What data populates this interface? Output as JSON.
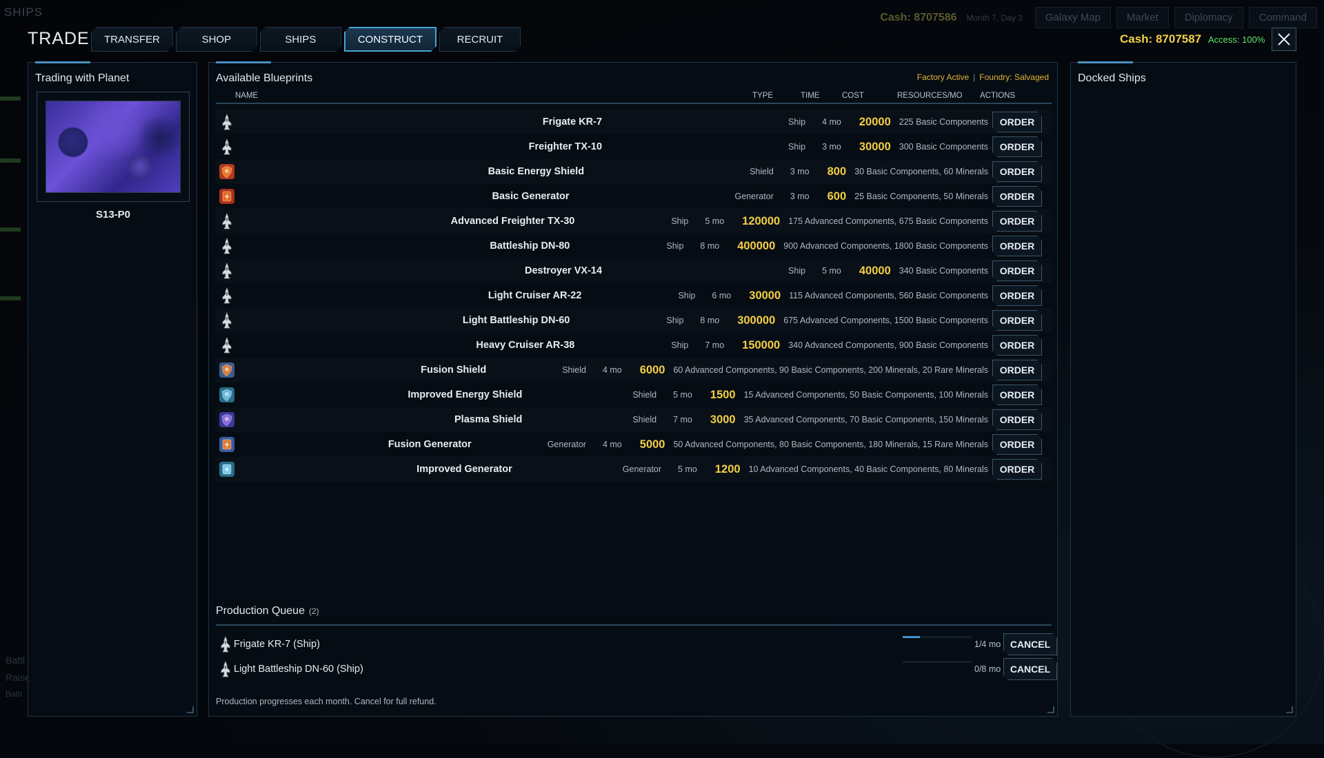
{
  "background": {
    "title": "SHIPS",
    "cash": "Cash: 8707586",
    "date": "Month 7, Day 3",
    "nav": [
      "Galaxy Map",
      "Market",
      "Diplomacy",
      "Command"
    ],
    "bottom_lines": [
      "Battl",
      "Raise",
      "Battl"
    ]
  },
  "header": {
    "title": "TRADE",
    "tabs": [
      {
        "label": "TRANSFER",
        "active": false
      },
      {
        "label": "SHOP",
        "active": false
      },
      {
        "label": "SHIPS",
        "active": false
      },
      {
        "label": "CONSTRUCT",
        "active": true
      },
      {
        "label": "RECRUIT",
        "active": false
      }
    ],
    "cash": "Cash: 8707587",
    "access": "Access: 100%"
  },
  "left_panel": {
    "title": "Trading with Planet",
    "planet_name": "S13-P0"
  },
  "blueprints": {
    "title": "Available Blueprints",
    "status": {
      "factory": "Factory Active",
      "separator": "|",
      "foundry": "Foundry: Salvaged"
    },
    "columns": {
      "name": "NAME",
      "type": "TYPE",
      "time": "TIME",
      "cost": "COST",
      "resources": "RESOURCES/MO",
      "actions": "ACTIONS"
    },
    "order_label": "ORDER",
    "rows": [
      {
        "name": "Frigate KR-7",
        "type": "Ship",
        "time": "4 mo",
        "cost": "20000",
        "resources": "225 Basic Components",
        "icon": "ship-icon",
        "gap": 270
      },
      {
        "name": "Freighter TX-10",
        "type": "Ship",
        "time": "3 mo",
        "cost": "30000",
        "resources": "300 Basic Components",
        "icon": "ship-icon",
        "gap": 270
      },
      {
        "name": "Basic Energy Shield",
        "type": "Shield",
        "time": "3 mo",
        "cost": "800",
        "resources": "30 Basic Components, 60 Minerals",
        "icon": "shield-icon",
        "gap": 240
      },
      {
        "name": "Basic Generator",
        "type": "Generator",
        "time": "3 mo",
        "cost": "600",
        "resources": "25 Basic Components, 50 Minerals",
        "icon": "generator-icon",
        "gap": 240
      },
      {
        "name": "Advanced Freighter TX-30",
        "type": "Ship",
        "time": "5 mo",
        "cost": "120000",
        "resources": "175 Advanced Components, 675 Basic Components",
        "icon": "ship-icon",
        "gap": 140
      },
      {
        "name": "Battleship DN-80",
        "type": "Ship",
        "time": "8 mo",
        "cost": "400000",
        "resources": "900 Advanced Components, 1800 Basic Components",
        "icon": "ship-icon",
        "gap": 140
      },
      {
        "name": "Destroyer VX-14",
        "type": "Ship",
        "time": "5 mo",
        "cost": "40000",
        "resources": "340 Basic Components",
        "icon": "ship-icon",
        "gap": 270
      },
      {
        "name": "Light Cruiser AR-22",
        "type": "Ship",
        "time": "6 mo",
        "cost": "30000",
        "resources": "115 Advanced Components, 560 Basic Components",
        "icon": "ship-icon",
        "gap": 140
      },
      {
        "name": "Light Battleship DN-60",
        "type": "Ship",
        "time": "8 mo",
        "cost": "300000",
        "resources": "675 Advanced Components, 1500 Basic Components",
        "icon": "ship-icon",
        "gap": 140
      },
      {
        "name": "Heavy Cruiser AR-38",
        "type": "Ship",
        "time": "7 mo",
        "cost": "150000",
        "resources": "340 Advanced Components, 900 Basic Components",
        "icon": "ship-icon",
        "gap": 140
      },
      {
        "name": "Fusion Shield",
        "type": "Shield",
        "time": "4 mo",
        "cost": "6000",
        "resources": "60 Advanced Components, 90 Basic Components, 200 Minerals, 20 Rare Minerals",
        "icon": "shield-icon",
        "gap": 110
      },
      {
        "name": "Improved Energy Shield",
        "type": "Shield",
        "time": "5 mo",
        "cost": "1500",
        "resources": "15 Advanced Components, 50 Basic Components, 100 Minerals",
        "icon": "shield-icon",
        "gap": 160
      },
      {
        "name": "Plasma Shield",
        "type": "Shield",
        "time": "7 mo",
        "cost": "3000",
        "resources": "35 Advanced Components, 70 Basic Components, 150 Minerals",
        "icon": "shield-icon",
        "gap": 160
      },
      {
        "name": "Fusion Generator",
        "type": "Generator",
        "time": "4 mo",
        "cost": "5000",
        "resources": "50 Advanced Components, 80 Basic Components, 180 Minerals, 15 Rare Minerals",
        "icon": "generator-icon",
        "gap": 110
      },
      {
        "name": "Improved Generator",
        "type": "Generator",
        "time": "5 mo",
        "cost": "1200",
        "resources": "10 Advanced Components, 40 Basic Components, 80 Minerals",
        "icon": "generator-icon",
        "gap": 160
      }
    ]
  },
  "queue": {
    "title": "Production Queue",
    "count": "(2)",
    "cancel_label": "CANCEL",
    "items": [
      {
        "name": "Frigate KR-7 (Ship)",
        "progress": "1/4 mo",
        "fraction": 0.25
      },
      {
        "name": "Light Battleship DN-60 (Ship)",
        "progress": "0/8 mo",
        "fraction": 0
      }
    ],
    "footnote": "Production progresses each month. Cancel for full refund."
  },
  "right_panel": {
    "title": "Docked Ships"
  },
  "colors": {
    "accent": "#4aa3d6",
    "cost": "#f3cf45",
    "status": "#e2b43a",
    "access": "#5ee46a"
  }
}
